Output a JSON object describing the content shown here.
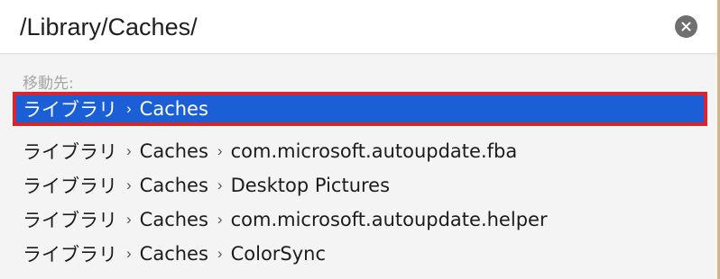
{
  "path_bar": {
    "value": "/Library/Caches/"
  },
  "icons": {
    "clear": "clear-circle-x-icon",
    "separator": "chevron-right-icon"
  },
  "colors": {
    "selection": "#1b5fd6",
    "highlight_border": "#d9252f"
  },
  "results": {
    "section_label": "移動先:",
    "rows": [
      {
        "segments": [
          "ライブラリ",
          "Caches"
        ],
        "selected": true
      },
      {
        "segments": [
          "ライブラリ",
          "Caches",
          "com.microsoft.autoupdate.fba"
        ],
        "selected": false
      },
      {
        "segments": [
          "ライブラリ",
          "Caches",
          "Desktop Pictures"
        ],
        "selected": false
      },
      {
        "segments": [
          "ライブラリ",
          "Caches",
          "com.microsoft.autoupdate.helper"
        ],
        "selected": false
      },
      {
        "segments": [
          "ライブラリ",
          "Caches",
          "ColorSync"
        ],
        "selected": false
      }
    ]
  }
}
